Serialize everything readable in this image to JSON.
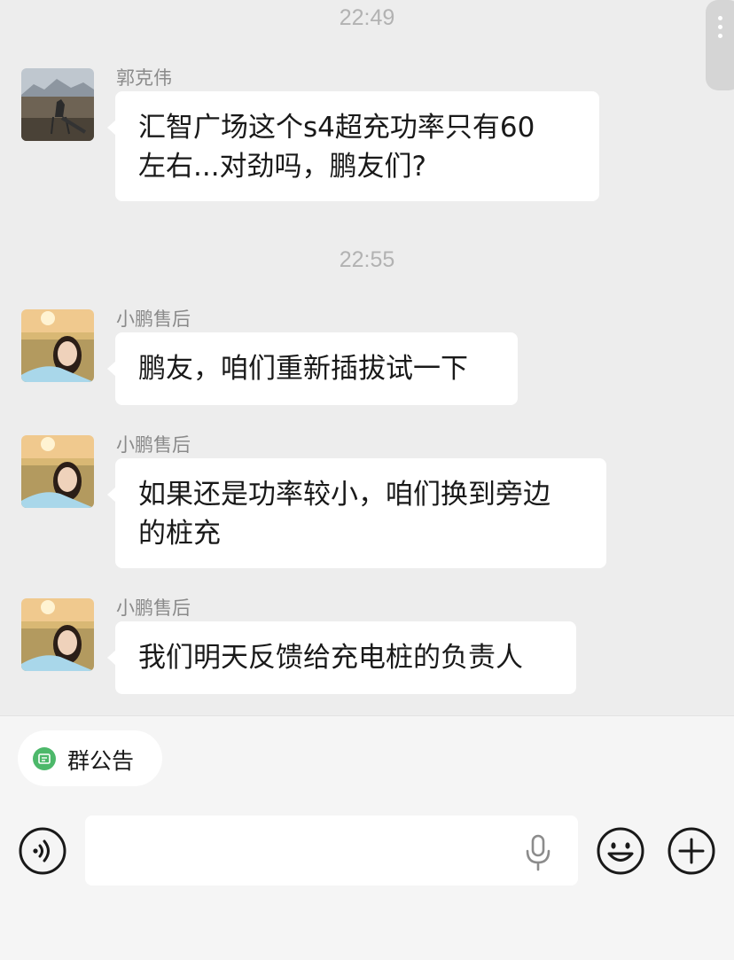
{
  "chat": {
    "timestamps": [
      "22:49",
      "22:55"
    ],
    "messages": [
      {
        "sender": "郭克伟",
        "lines": [
          "汇智广场这个s4超充功率只有60",
          "左右...对劲吗，鹏友们?"
        ]
      },
      {
        "sender": "小鹏售后",
        "lines": [
          "鹏友，咱们重新插拔试一下"
        ]
      },
      {
        "sender": "小鹏售后",
        "lines": [
          "如果还是功率较小，咱们换到旁边",
          "的桩充"
        ]
      },
      {
        "sender": "小鹏售后",
        "lines": [
          "我们明天反馈给充电桩的负责人"
        ]
      }
    ]
  },
  "bottom_bar": {
    "announcement_label": "群公告",
    "input_value": "",
    "icons": [
      "voice-icon",
      "mic-icon",
      "emoji-icon",
      "plus-icon",
      "announcement-icon"
    ]
  },
  "colors": {
    "chat_background": "#ededed",
    "bubble": "#ffffff",
    "announcement_icon": "#4cb86a"
  }
}
